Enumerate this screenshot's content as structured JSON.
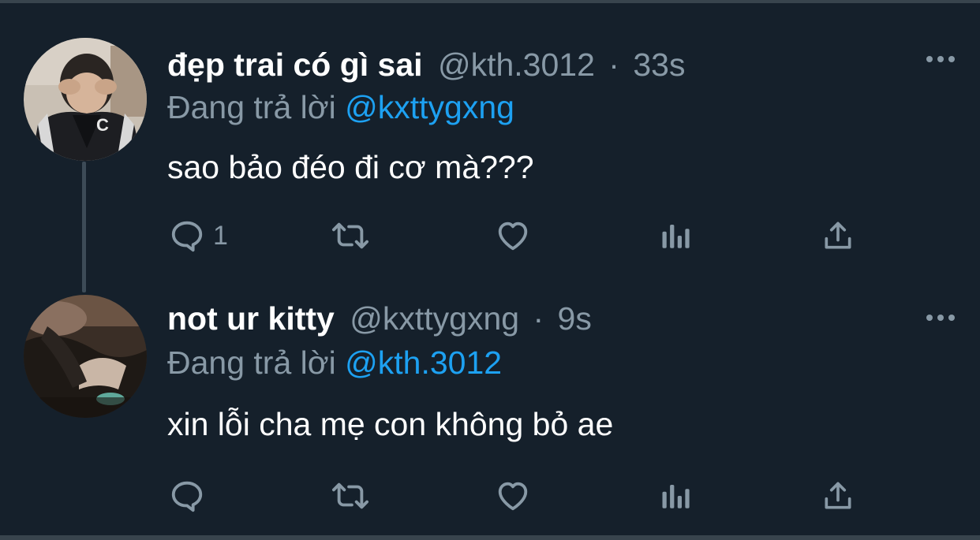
{
  "tweets": [
    {
      "name": "đẹp trai có gì sai",
      "handle": "@kth.3012",
      "separator": "·",
      "time": "33s",
      "replying_prefix": "Đang trả lời",
      "replying_to": "@kxttygxng",
      "text": "sao bảo đéo đi cơ mà???",
      "reply_count": "1"
    },
    {
      "name": "not ur kitty",
      "handle": "@kxttygxng",
      "separator": "·",
      "time": "9s",
      "replying_prefix": "Đang trả lời",
      "replying_to": "@kth.3012",
      "text": "xin lỗi cha mẹ con không bỏ ae",
      "reply_count": ""
    }
  ],
  "icons": {
    "reply": "speech-bubble-icon",
    "retweet": "retweet-icon",
    "like": "heart-icon",
    "analytics": "bar-chart-icon",
    "share": "share-upload-icon",
    "more": "more-dots-icon"
  },
  "colors": {
    "background": "#15202b",
    "primary_text": "#ffffff",
    "secondary_text": "#8899a6",
    "link": "#1da1f2",
    "divider": "#38444d"
  }
}
